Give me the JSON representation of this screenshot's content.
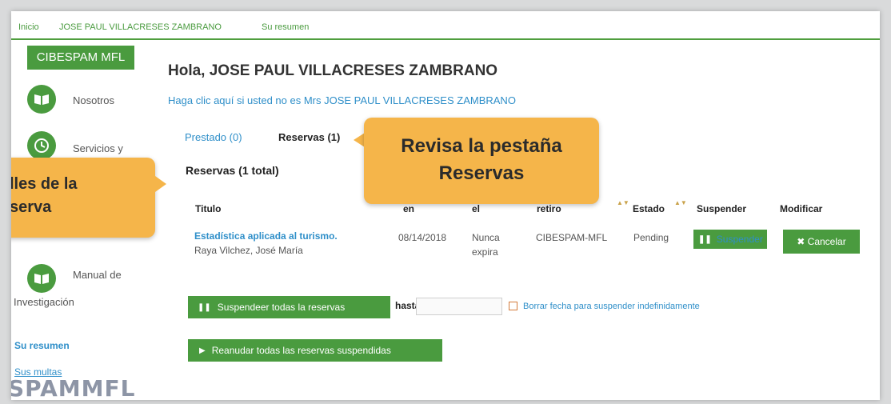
{
  "breadcrumb": [
    "Inicio",
    "JOSE PAUL VILLACRESES ZAMBRANO",
    "Su resumen"
  ],
  "sidebar": {
    "brand": "CIBESPAM MFL",
    "items": [
      {
        "label": "Nosotros",
        "icon": "book-icon"
      },
      {
        "label": "Servicios y",
        "icon": "history-icon"
      },
      {
        "label": "Manual de",
        "label2": "Investigación",
        "icon": "book-icon"
      }
    ],
    "links": [
      "Su resumen",
      "Sus multas"
    ]
  },
  "main": {
    "greeting": "Hola, JOSE PAUL VILLACRESES ZAMBRANO",
    "not_me": "Haga clic aquí si usted no es Mrs JOSE PAUL VILLACRESES ZAMBRANO",
    "tabs": [
      {
        "label": "Prestado (0)",
        "active": false
      },
      {
        "label": "Reservas (1)",
        "active": true
      }
    ],
    "section_title": "Reservas (1 total)",
    "table": {
      "headers": [
        "Titulo",
        "en",
        "el",
        "retiro",
        "Estado",
        "Suspender",
        "Modificar"
      ],
      "rows": [
        {
          "title": "Estadística aplicada al turismo.",
          "author": "Raya Vilchez, José María",
          "date": "08/14/2018",
          "expires_1": "Nunca",
          "expires_2": "expira",
          "location": "CIBESPAM-MFL",
          "status": "Pending",
          "suspend_label": "Suspender",
          "cancel_label": "✖ Cancelar"
        }
      ]
    },
    "suspend_all_label": "Suspendeer todas la reservas",
    "until_label": "hasta",
    "date_value": "",
    "clear_date_label": "Borrar fecha para suspender indefinidamente",
    "resume_all_label": "Reanudar todas las reservas suspendidas"
  },
  "callouts": {
    "right": [
      "Revisa la pestaña",
      "Reservas"
    ],
    "left": [
      "lles de la",
      "serva"
    ]
  },
  "stamp_text": "SPAMMFL",
  "colors": {
    "accent_green": "#4a9b3f",
    "link_blue": "#2f8fc9",
    "callout_orange": "#f5b54a"
  }
}
